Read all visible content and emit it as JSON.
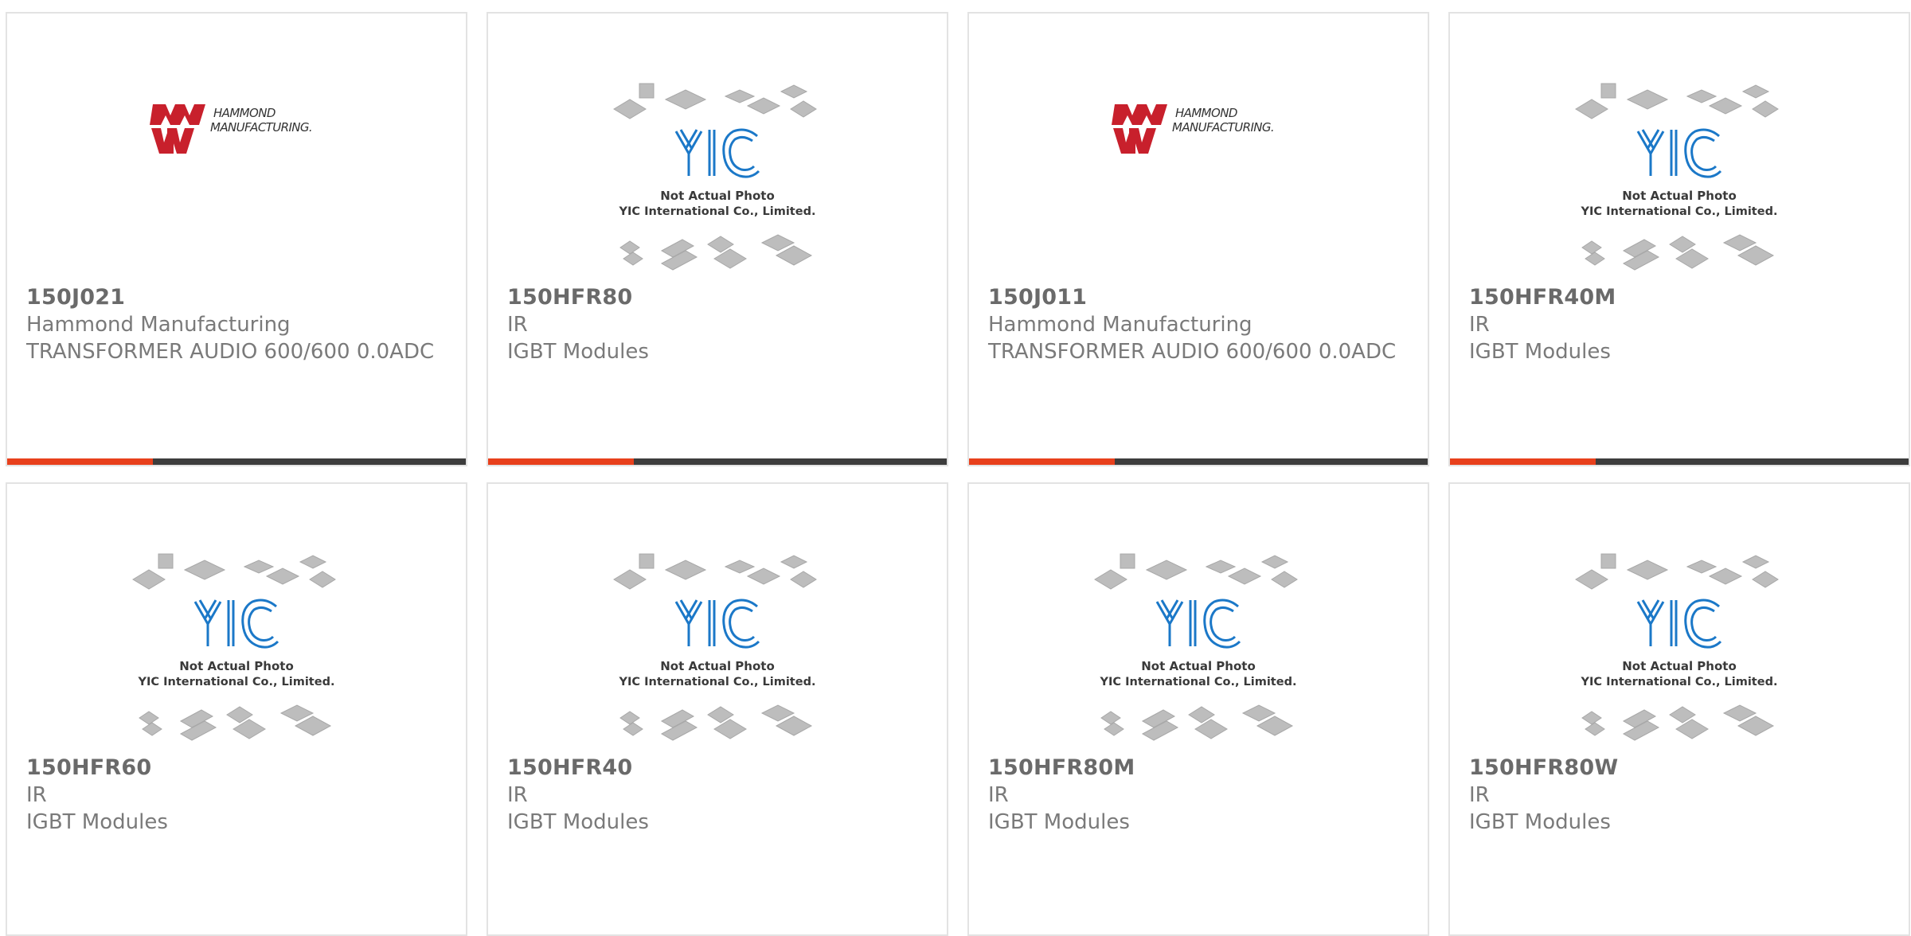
{
  "colors": {
    "accent": "#e8401c",
    "bar": "#3d3d3d",
    "text": "#717171",
    "hammond_red": "#c8202c",
    "yic_blue": "#1b78c8"
  },
  "products": [
    {
      "part": "150J021",
      "mfr": "Hammond Manufacturing",
      "desc": "TRANSFORMER AUDIO 600/600 0.0ADC",
      "image": "hammond-logo",
      "logo_text": [
        "HAMMOND",
        "MANUFACTURING."
      ]
    },
    {
      "part": "150HFR80",
      "mfr": "IR",
      "desc": "IGBT Modules",
      "image": "yic-placeholder",
      "photo_text": [
        "Not Actual Photo",
        "YIC International Co., Limited."
      ]
    },
    {
      "part": "150J011",
      "mfr": "Hammond Manufacturing",
      "desc": "TRANSFORMER AUDIO 600/600 0.0ADC",
      "image": "hammond-logo",
      "logo_text": [
        "HAMMOND",
        "MANUFACTURING."
      ]
    },
    {
      "part": "150HFR40M",
      "mfr": "IR",
      "desc": "IGBT Modules",
      "image": "yic-placeholder",
      "photo_text": [
        "Not Actual Photo",
        "YIC International Co., Limited."
      ]
    },
    {
      "part": "150HFR60",
      "mfr": "IR",
      "desc": "IGBT Modules",
      "image": "yic-placeholder",
      "photo_text": [
        "Not Actual Photo",
        "YIC International Co., Limited."
      ]
    },
    {
      "part": "150HFR40",
      "mfr": "IR",
      "desc": "IGBT Modules",
      "image": "yic-placeholder",
      "photo_text": [
        "Not Actual Photo",
        "YIC International Co., Limited."
      ]
    },
    {
      "part": "150HFR80M",
      "mfr": "IR",
      "desc": "IGBT Modules",
      "image": "yic-placeholder",
      "photo_text": [
        "Not Actual Photo",
        "YIC International Co., Limited."
      ]
    },
    {
      "part": "150HFR80W",
      "mfr": "IR",
      "desc": "IGBT Modules",
      "image": "yic-placeholder",
      "photo_text": [
        "Not Actual Photo",
        "YIC International Co., Limited."
      ]
    }
  ]
}
